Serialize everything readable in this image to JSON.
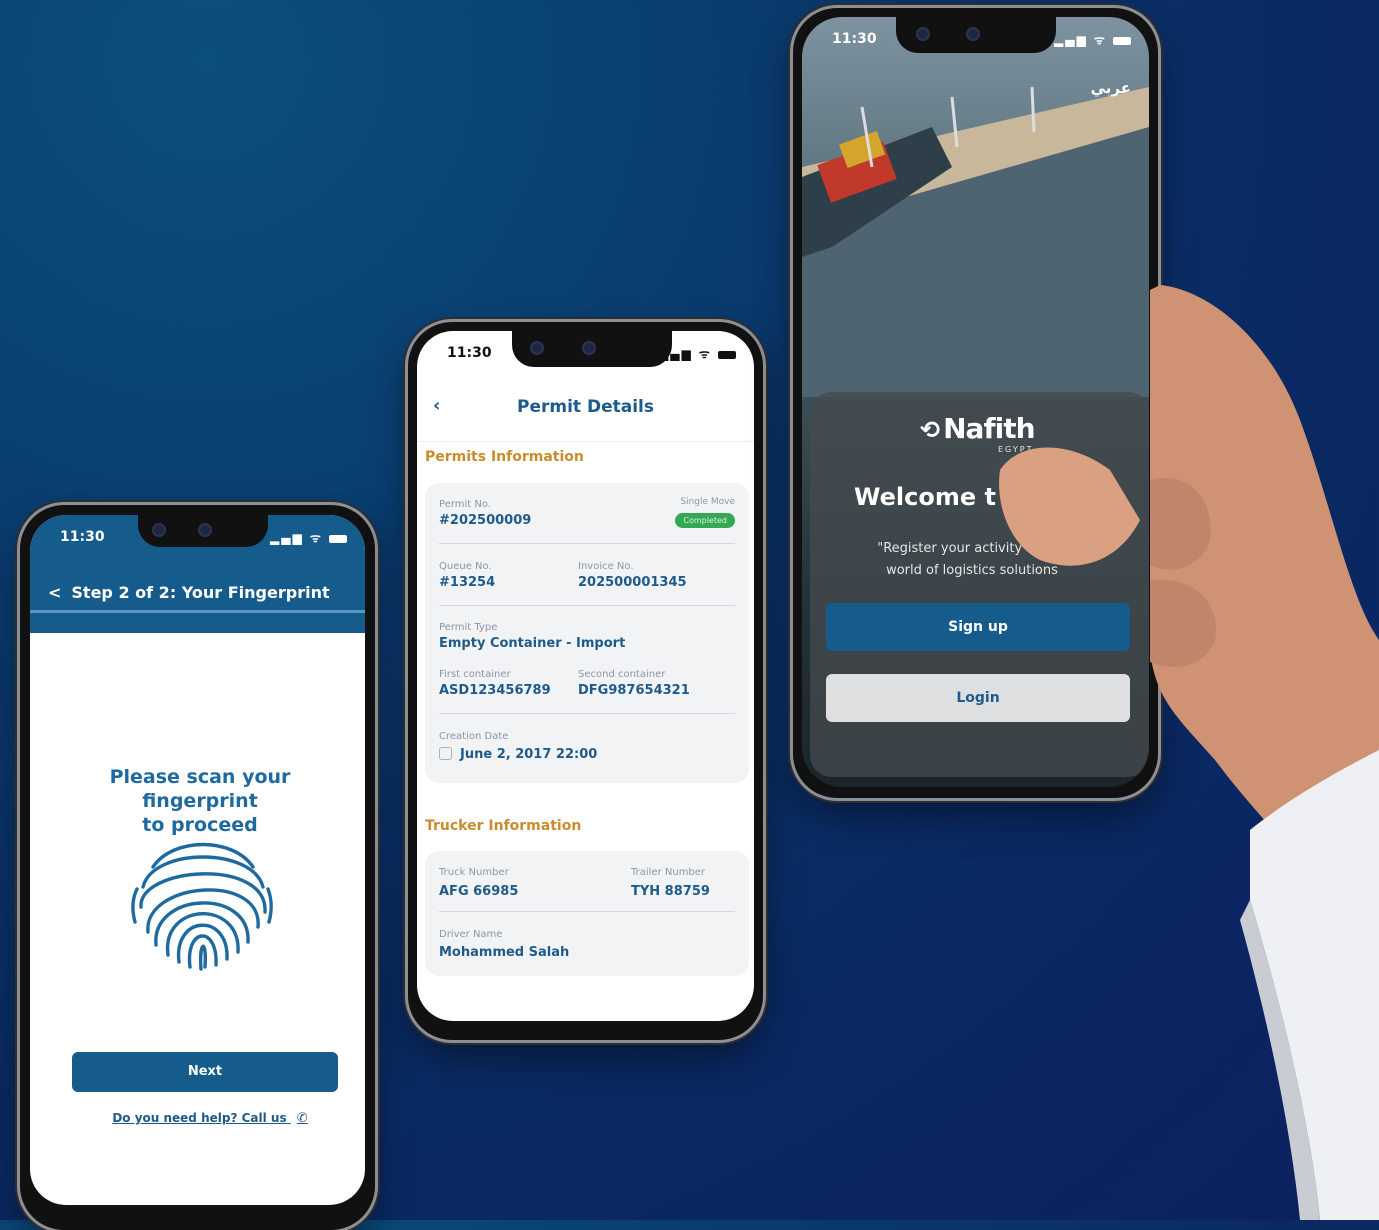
{
  "fingerprint_screen": {
    "status_time": "11:30",
    "title": "Step 2 of 2: Your Fingerprint",
    "prompt_line1": "Please scan your fingerprint",
    "prompt_line2": "to proceed",
    "next_label": "Next",
    "help_text": "Do you need help? Call us"
  },
  "permit_screen": {
    "status_time": "11:30",
    "title": "Permit Details",
    "permits_section": "Permits Information",
    "permit_no_label": "Permit No.",
    "permit_no": "#202500009",
    "move_type": "Single Move",
    "status": "Completed",
    "queue_no_label": "Queue No.",
    "queue_no": "#13254",
    "invoice_no_label": "Invoice No.",
    "invoice_no": "202500001345",
    "permit_type_label": "Permit Type",
    "permit_type": "Empty Container - Import",
    "first_container_label": "First container",
    "first_container": "ASD123456789",
    "second_container_label": "Second container",
    "second_container": "DFG987654321",
    "creation_date_label": "Creation Date",
    "creation_date": "June 2, 2017 22:00",
    "trucker_section": "Trucker Information",
    "truck_number_label": "Truck Number",
    "truck_number": "AFG 66985",
    "trailer_number_label": "Trailer Number",
    "trailer_number": "TYH 88759",
    "driver_name_label": "Driver Name",
    "driver_name": "Mohammed Salah"
  },
  "welcome_screen": {
    "status_time": "11:30",
    "language_toggle": "عربي",
    "logo_text": "Nafith",
    "logo_sub": "EGYPT",
    "welcome_text": "Welcome t",
    "tagline_line1": "\"Register your activity and di",
    "tagline_line2": "world of logistics solutions",
    "signup_label": "Sign up",
    "login_label": "Login"
  },
  "colors": {
    "brand_blue": "#155b8c",
    "accent_orange": "#c98d2c",
    "status_green": "#34a853"
  }
}
